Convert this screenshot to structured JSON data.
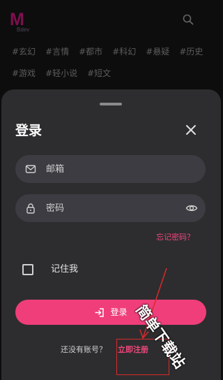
{
  "app": {
    "logo_letter": "M",
    "logo_sub": "Bdev"
  },
  "tags": {
    "row1": [
      "#玄幻",
      "#言情",
      "#都市",
      "#科幻",
      "#悬疑",
      "#历史"
    ],
    "row2": [
      "#游戏",
      "#轻小说",
      "#短文"
    ]
  },
  "login_sheet": {
    "title": "登录",
    "email_placeholder": "邮箱",
    "password_placeholder": "密码",
    "forgot_password": "忘记密码？",
    "remember_me": "记住我",
    "login_button": "登录",
    "no_account": "还没有账号？",
    "register_link": "立即注册"
  },
  "watermark": {
    "text": "简单下载站"
  },
  "colors": {
    "accent": "#f03e7a",
    "link": "#f0477c",
    "sheet_bg": "#2d2d2f",
    "field_bg": "#3d3c42",
    "logo": "#c2187a"
  },
  "icons": {
    "search": "search-icon",
    "close": "close-icon",
    "email": "envelope-icon",
    "password": "lock-icon",
    "visibility": "eye-icon",
    "login": "login-arrow-icon"
  }
}
